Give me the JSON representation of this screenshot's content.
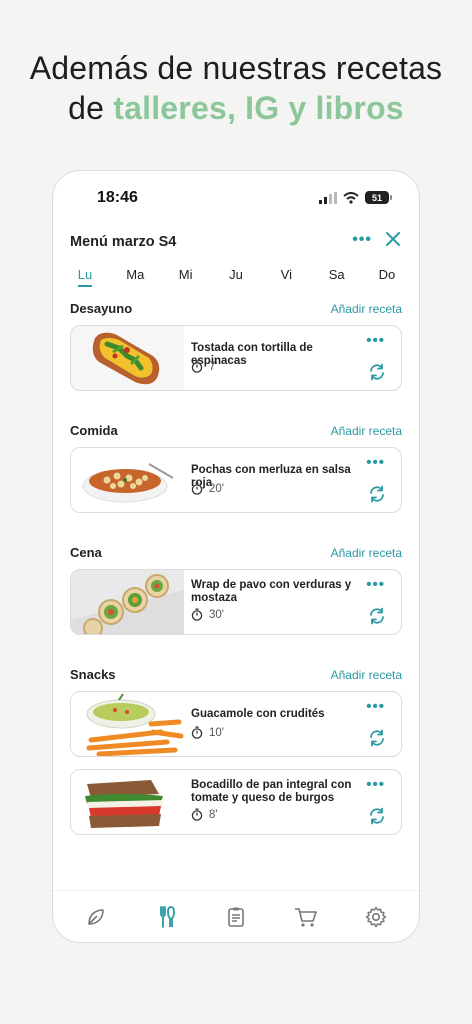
{
  "headline": {
    "line1": "Además de nuestras recetas",
    "line2_prefix": "de ",
    "line2_accent": "talleres, IG y libros"
  },
  "status": {
    "time": "18:46",
    "battery": "51"
  },
  "menu": {
    "title": "Menú marzo S4",
    "more": "•••"
  },
  "days": [
    "Lu",
    "Ma",
    "Mi",
    "Ju",
    "Vi",
    "Sa",
    "Do"
  ],
  "active_day": "Lu",
  "add_label": "Añadir receta",
  "sections": [
    {
      "title": "Desayuno",
      "recipes": [
        {
          "title": "Tostada con tortilla de espinacas",
          "time": "7'"
        }
      ]
    },
    {
      "title": "Comida",
      "recipes": [
        {
          "title": "Pochas con merluza en salsa roja",
          "time": "20'"
        }
      ]
    },
    {
      "title": "Cena",
      "recipes": [
        {
          "title": "Wrap de pavo con verduras y mostaza",
          "time": "30'"
        }
      ]
    },
    {
      "title": "Snacks",
      "recipes": [
        {
          "title": "Guacamole con crudités",
          "time": "10'"
        },
        {
          "title": "Bocadillo de pan integral con tomate y queso de burgos",
          "time": "8'"
        }
      ]
    }
  ],
  "tabs": [
    "leaf-icon",
    "cutlery-icon",
    "clipboard-icon",
    "cart-icon",
    "gear-icon"
  ],
  "colors": {
    "accent": "#2a9aa2",
    "headline_accent": "#8cc79a"
  }
}
